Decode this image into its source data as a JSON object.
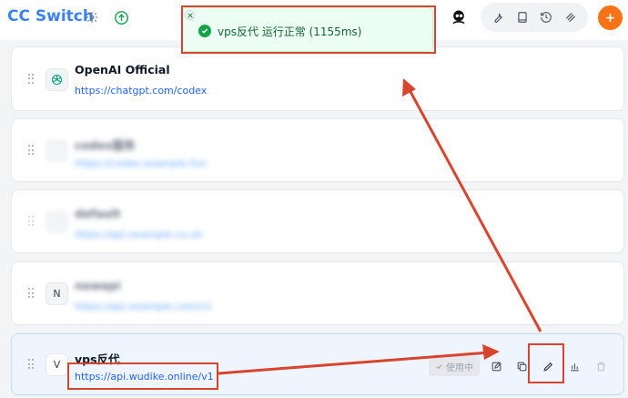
{
  "app": {
    "title": "CC Switch"
  },
  "toast": {
    "message": "vps反代 运行正常 (1155ms)"
  },
  "header_icons": [
    "settings-gear-icon",
    "update-arrow-up-icon",
    "wrench-icon",
    "book-icon",
    "history-icon",
    "mcp-icon",
    "plus-icon"
  ],
  "providers": [
    {
      "name": "OpenAI Official",
      "url": "https://chatgpt.com/codex",
      "logo": "openai-logo",
      "blurred": false
    },
    {
      "name": "codex服务",
      "url": "https://codex.example.fun",
      "logo": "",
      "blurred": true
    },
    {
      "name": "default",
      "url": "https://api.example.co.uk",
      "logo": "",
      "blurred": true
    },
    {
      "name": "newapi",
      "url": "https://api.example.com/v1",
      "logo": "N",
      "blurred": true
    },
    {
      "name": "vps反代",
      "url": "https://api.wudike.online/v1",
      "logo": "V",
      "blurred": false
    }
  ],
  "active_actions": {
    "in_use_label": "使用中"
  },
  "colors": {
    "brand": "#3b82f6",
    "accent_orange": "#f97316",
    "success": "#16a34a",
    "link": "#2563eb",
    "annotation": "#d7452f"
  }
}
